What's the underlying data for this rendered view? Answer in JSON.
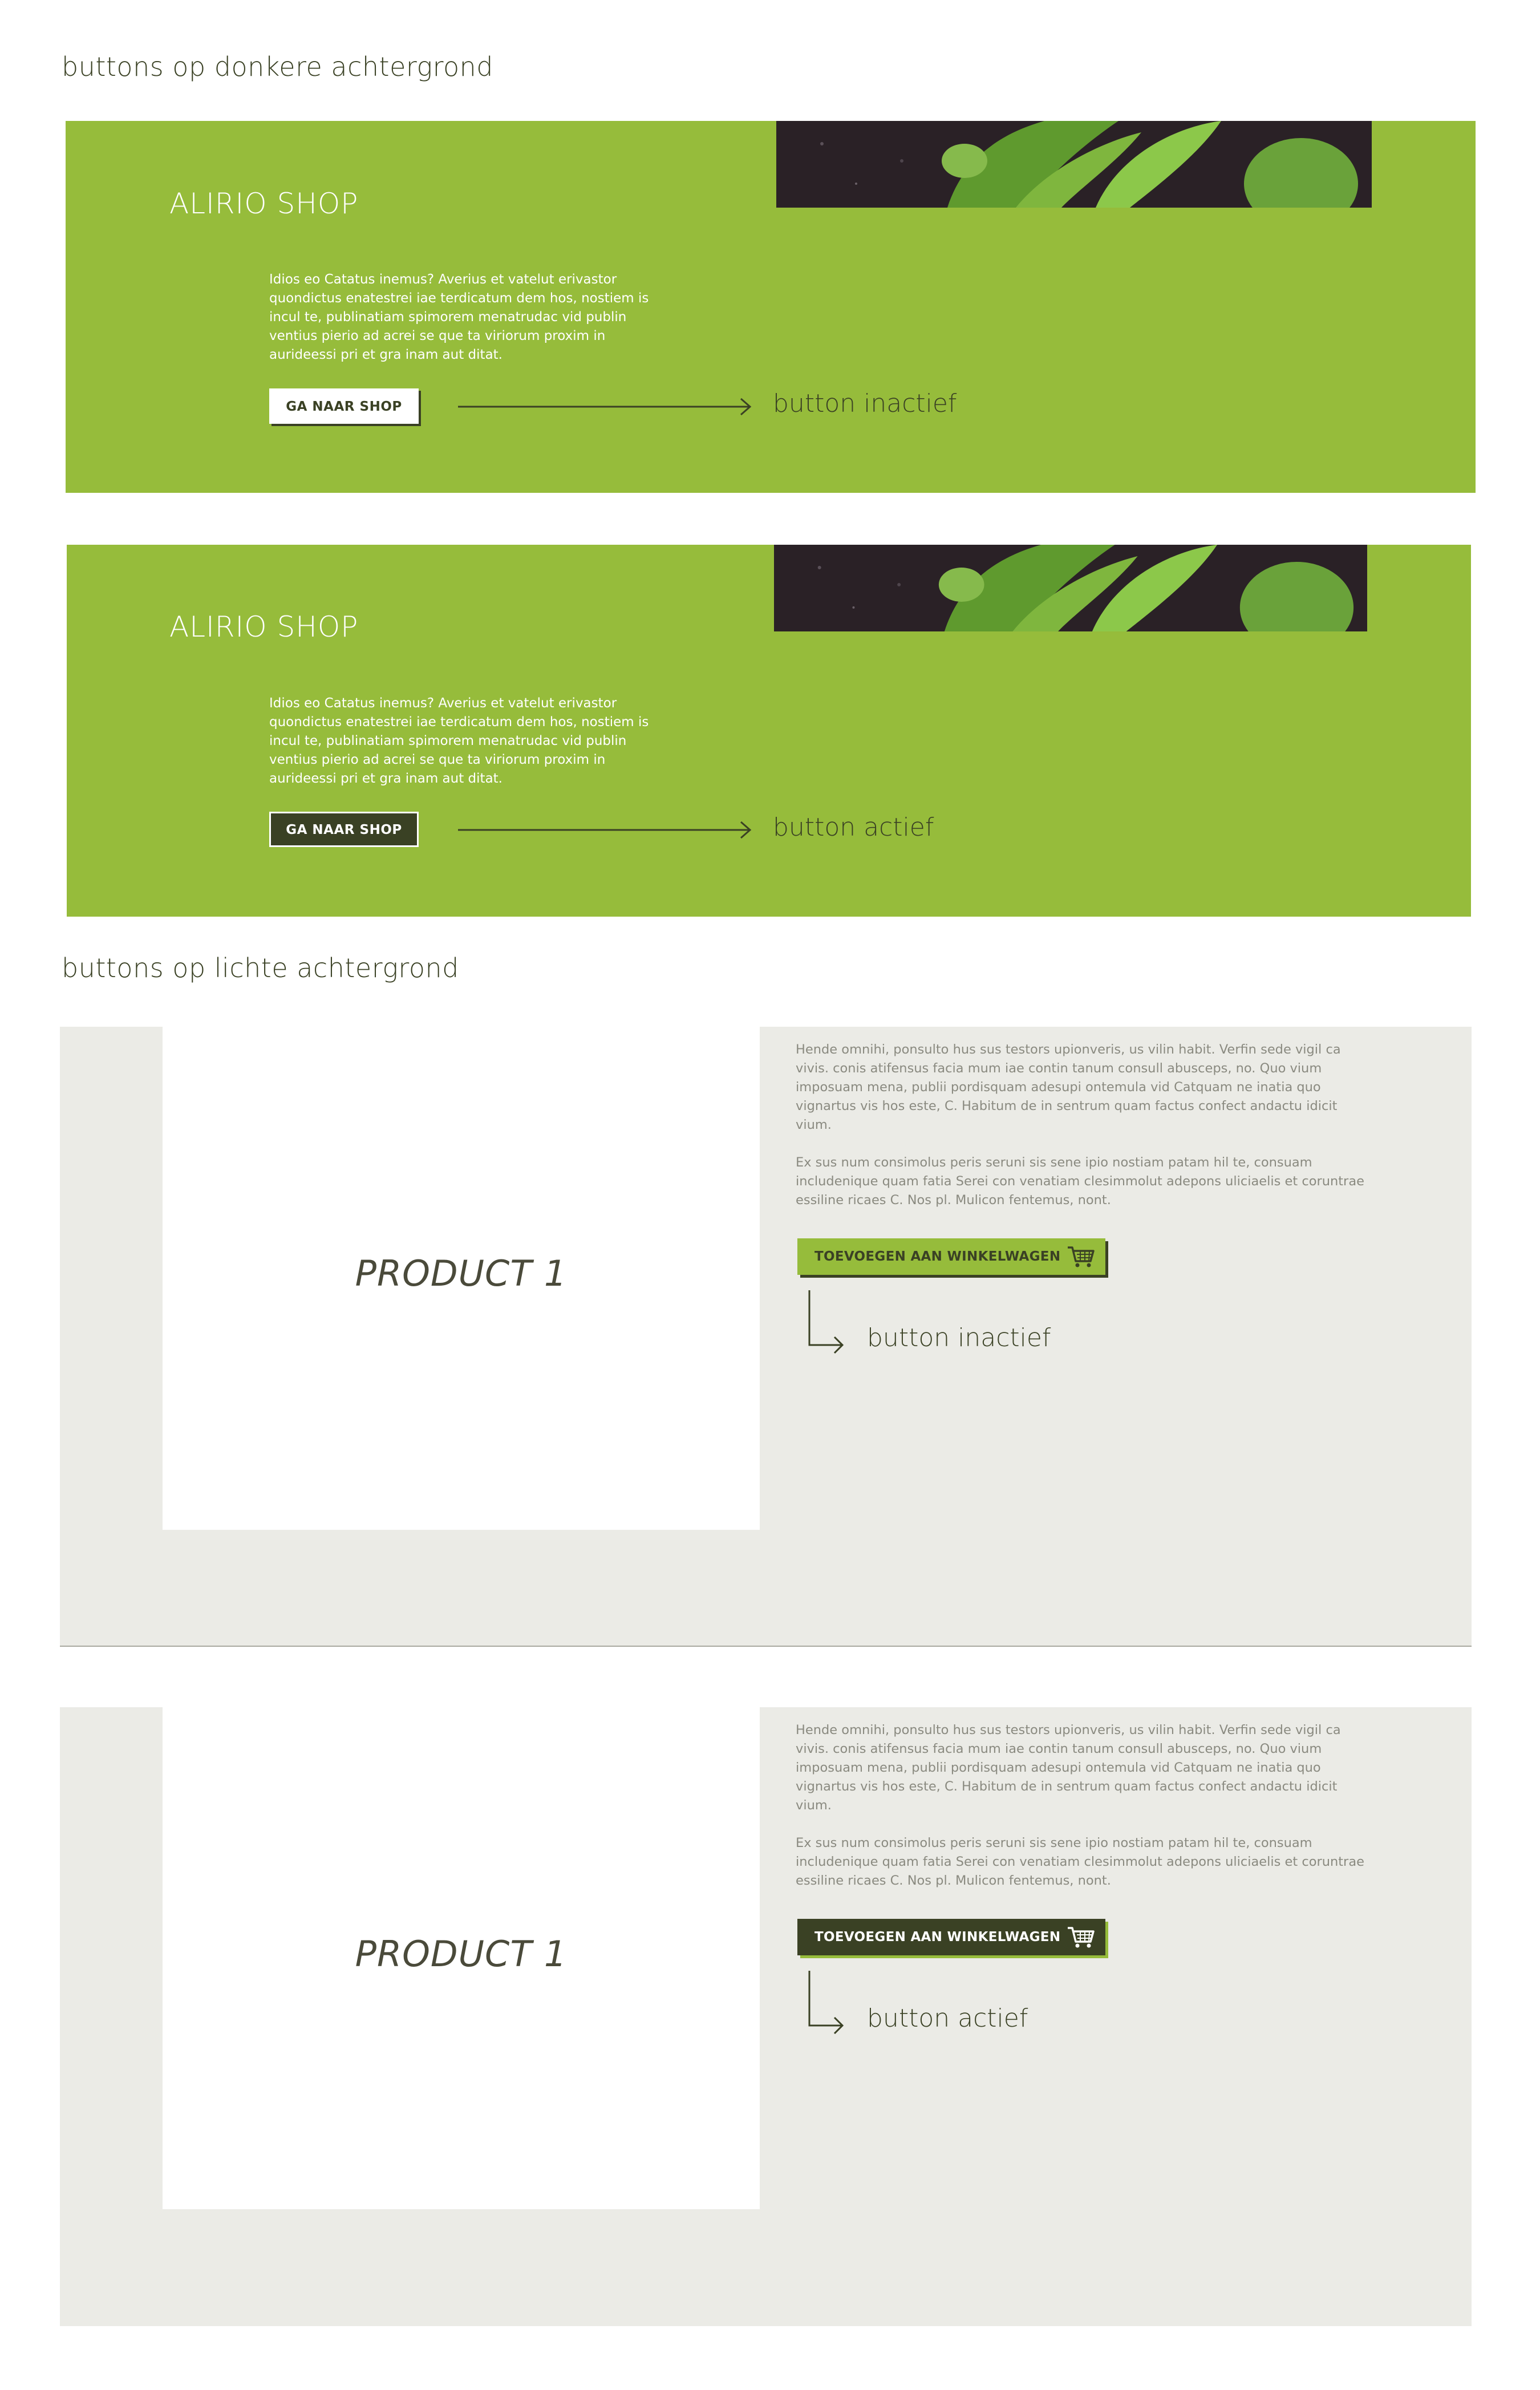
{
  "section_dark": {
    "heading": "buttons op donkere achtergrond"
  },
  "section_light": {
    "heading": "buttons op lichte achtergrond"
  },
  "shop": {
    "title": "ALIRIO SHOP",
    "body": "Idios eo Catatus inemus? Averius et vatelut erivastor quondictus enatestrei iae terdicatum dem hos, nostiem is incul te, publinatiam spimorem menatrudac vid publin ventius pierio ad acrei se que ta viriorum proxim in aurideessi pri et gra inam aut ditat.",
    "button_label": "GA NAAR SHOP"
  },
  "product": {
    "name": "PRODUCT 1",
    "paragraph_1": "Hende omnihi, ponsulto hus sus testors upionveris, us vilin habit. Verfin sede vigil ca vivis. conis atifensus facia mum iae contin tanum consull abusceps, no. Quo vium imposuam mena, publii pordisquam adesupi ontemula vid Catquam ne inatia quo vignartus vis hos este, C. Habitum de in sentrum quam factus confect andactu idicit vium.",
    "paragraph_2": "Ex sus num consimolus peris seruni sis sene ipio nostiam patam hil te, consuam includenique quam fatia Serei con venatiam clesimmolut adepons uliciaelis et coruntrae essiline ricaes C. Nos pl. Mulicon fentemus, nont.",
    "cart_button_label": "TOEVOEGEN AAN WINKELWAGEN"
  },
  "labels": {
    "inactive": "button inactief",
    "active": "button actief"
  },
  "icons": {
    "cart": "shopping-cart-icon",
    "arrow": "arrow-right-icon",
    "bent_arrow": "arrow-down-right-icon"
  },
  "colors": {
    "green": "#96bc3b",
    "dark_olive": "#3a4124",
    "light_gray": "#ebebe6",
    "white": "#ffffff"
  }
}
